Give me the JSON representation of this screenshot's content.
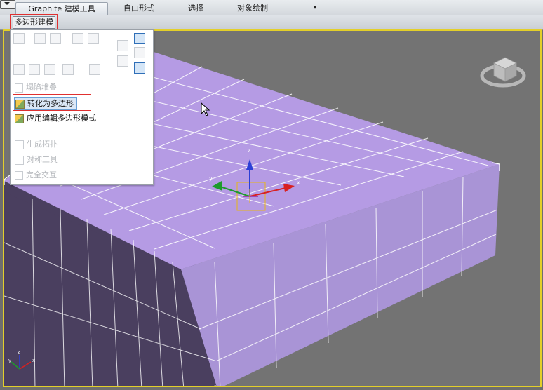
{
  "ribbon": {
    "tabs": [
      {
        "label": "Graphite 建模工具"
      },
      {
        "label": "自由形式"
      },
      {
        "label": "选择"
      },
      {
        "label": "对象绘制"
      }
    ],
    "sub_tab": "多边形建模"
  },
  "dropdown": {
    "items": [
      {
        "label": "塌陷堆叠",
        "enabled": false
      },
      {
        "label": "转化为多边形",
        "enabled": true,
        "highlighted": true
      },
      {
        "label": "应用编辑多边形模式",
        "enabled": true
      },
      {
        "label": "生成拓扑",
        "enabled": false
      },
      {
        "label": "对称工具",
        "enabled": false
      },
      {
        "label": "完全交互",
        "enabled": false
      }
    ]
  },
  "gizmo": {
    "z_label": "z",
    "x_label": "x",
    "y_label": "y"
  },
  "corner_axis": {
    "z_label": "z",
    "x_label": "x",
    "y_label": "y"
  },
  "colors": {
    "highlight_red": "#e03030",
    "viewport_border": "#e3cf2a",
    "box_top": "#b59be4",
    "box_side": "#b59be4",
    "box_dark_side": "#4a3f5f"
  }
}
